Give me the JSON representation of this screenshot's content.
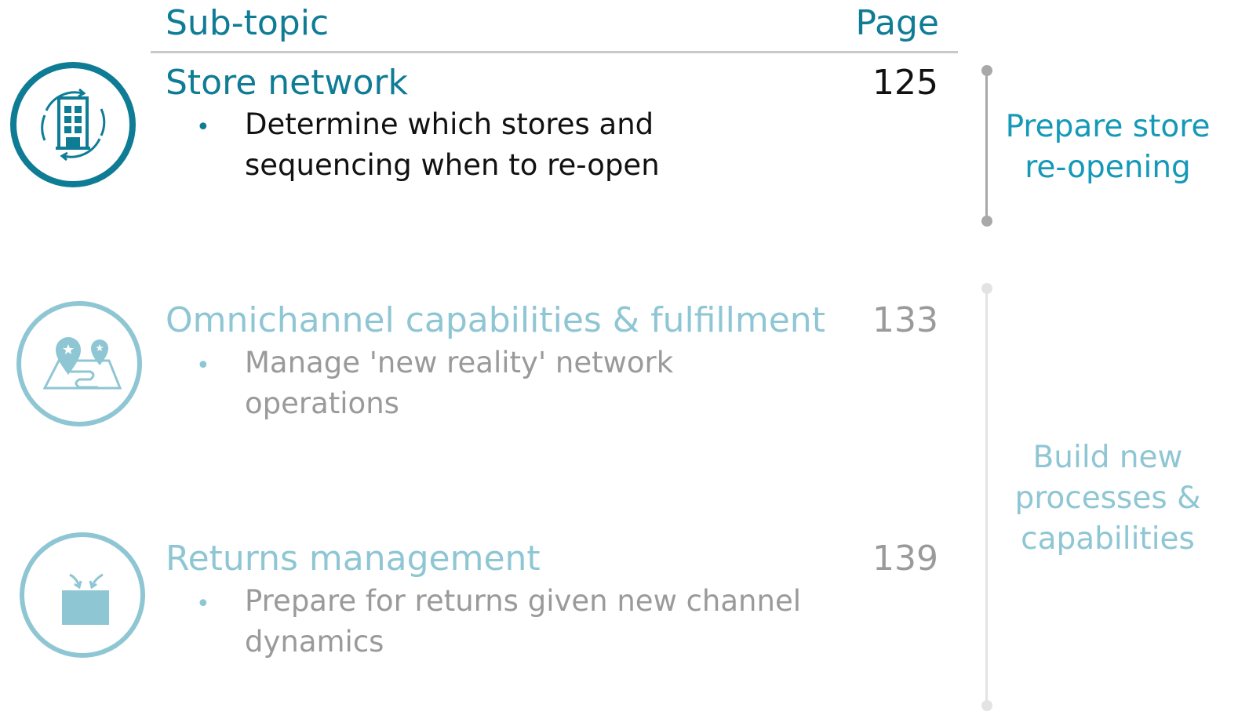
{
  "header": {
    "subtopic_label": "Sub-topic",
    "page_label": "Page"
  },
  "topics": [
    {
      "title": "Store network",
      "page": "125",
      "bullet": "•",
      "lines": [
        "Determine which stores and",
        "sequencing when to re-open"
      ],
      "icon": "store-cycle-icon"
    },
    {
      "title": "Omnichannel capabilities & fulfillment",
      "page": "133",
      "bullet": "•",
      "lines": [
        "Manage 'new reality' network",
        "operations"
      ],
      "icon": "map-pins-icon"
    },
    {
      "title": "Returns management",
      "page": "139",
      "bullet": "•",
      "lines": [
        "Prepare for returns given new channel",
        "dynamics"
      ],
      "icon": "return-box-icon"
    }
  ],
  "phases": [
    {
      "lines": [
        "Prepare store",
        "re-opening"
      ]
    },
    {
      "lines": [
        "Build new",
        "processes &",
        "capabilities"
      ]
    }
  ],
  "colors": {
    "teal_dark": "#0f7c96",
    "teal_light": "#8fc6d4",
    "gray_text": "#9a9a9a",
    "rule_gray": "#c9c9c9"
  }
}
